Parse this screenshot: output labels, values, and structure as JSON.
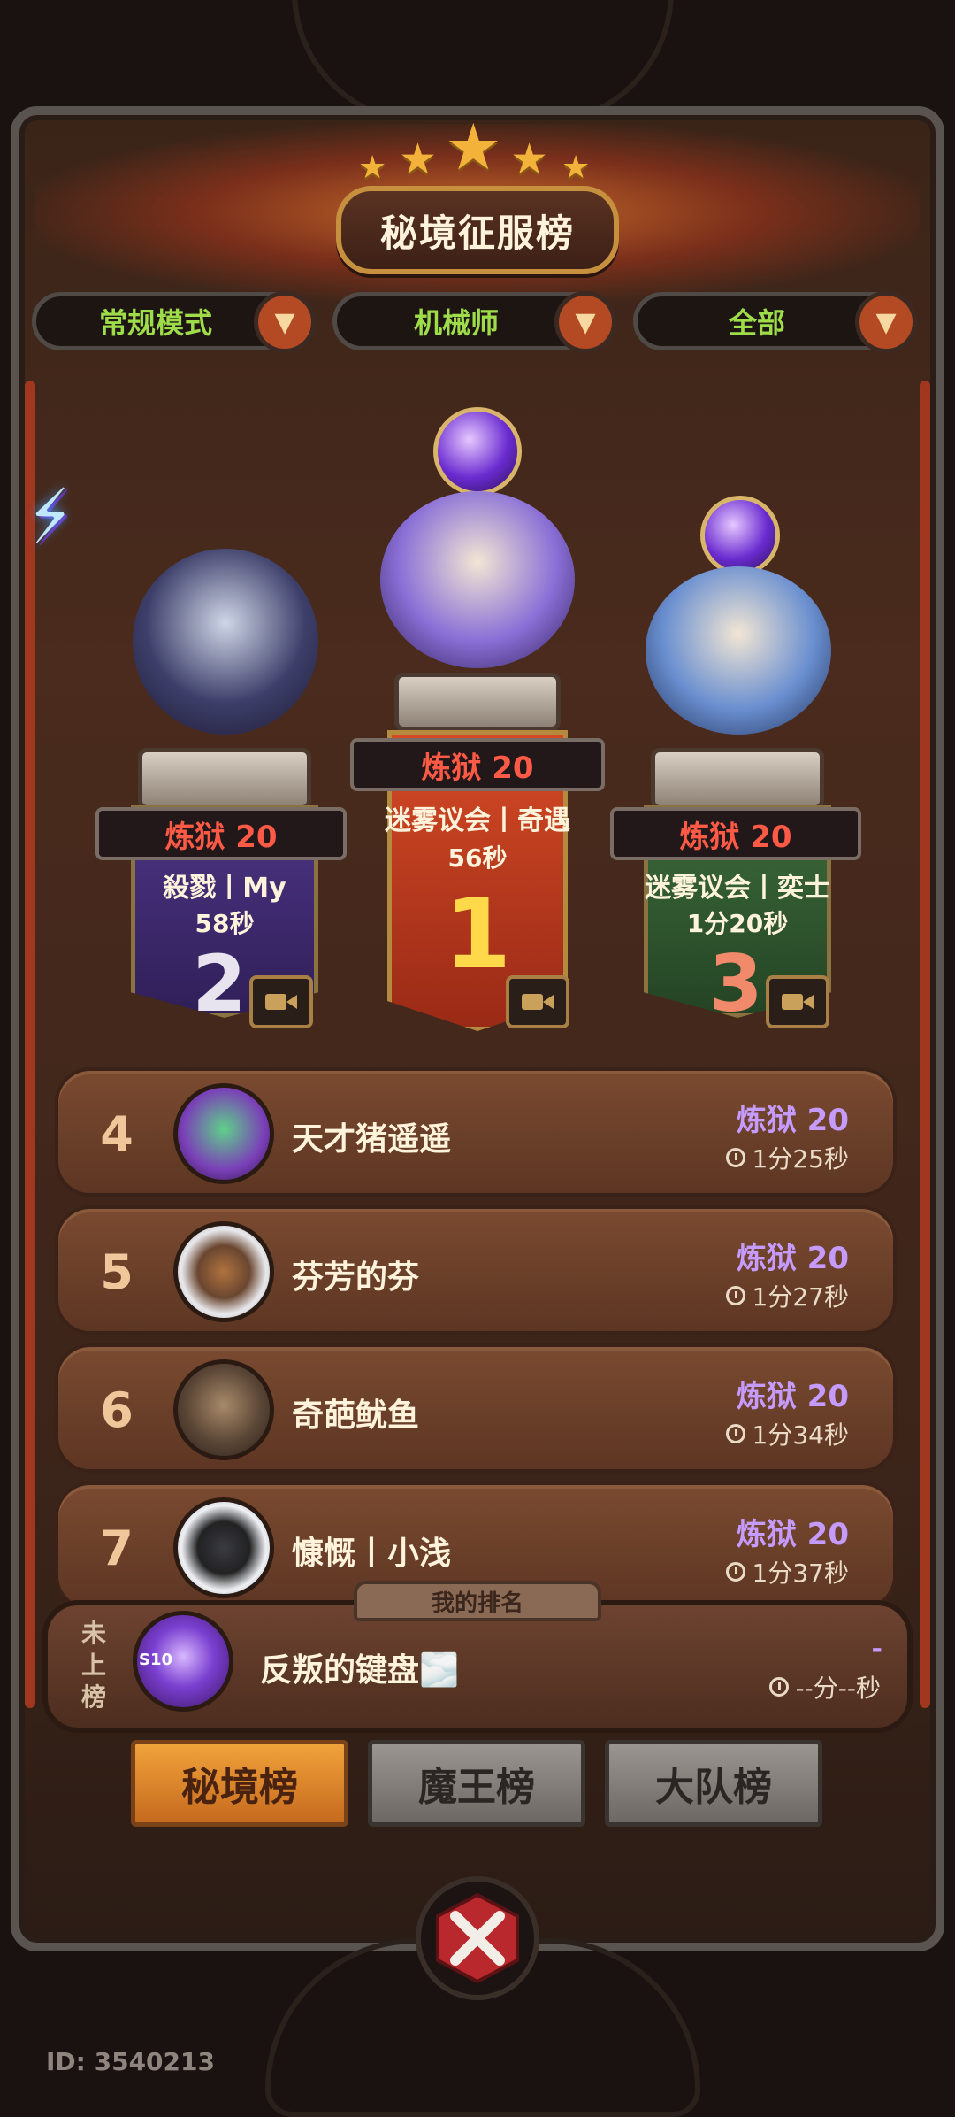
{
  "title": "秘境征服榜",
  "filters": [
    {
      "label": "常规模式"
    },
    {
      "label": "机械师"
    },
    {
      "label": "全部"
    }
  ],
  "podium": [
    {
      "rank": "1",
      "level": "炼狱 20",
      "name": "迷雾议会丨奇遇",
      "time": "56秒",
      "color": "#b5341f"
    },
    {
      "rank": "2",
      "level": "炼狱 20",
      "name": "殺戮丨My",
      "time": "58秒",
      "color": "#3e2a6e"
    },
    {
      "rank": "3",
      "level": "炼狱 20",
      "name": "迷雾议会丨奕士",
      "time": "1分20秒",
      "color": "#2f5230"
    }
  ],
  "rows": [
    {
      "rank": "4",
      "name": "天才猪遥遥",
      "level": "炼狱 20",
      "time": "1分25秒"
    },
    {
      "rank": "5",
      "name": "芬芳的芬",
      "level": "炼狱 20",
      "time": "1分27秒"
    },
    {
      "rank": "6",
      "name": "奇葩鱿鱼",
      "level": "炼狱 20",
      "time": "1分34秒"
    },
    {
      "rank": "7",
      "name": "慷慨丨小浅",
      "level": "炼狱 20",
      "time": "1分37秒"
    }
  ],
  "my_rank": {
    "tab_label": "我的排名",
    "status": "未上榜",
    "name": "反叛的键盘🌫️",
    "level": "-",
    "time": "--分--秒"
  },
  "tabs": [
    {
      "label": "秘境榜",
      "active": true
    },
    {
      "label": "魔王榜",
      "active": false
    },
    {
      "label": "大队榜",
      "active": false
    }
  ],
  "avatar_badge": "S10",
  "user_id": "ID: 3540213",
  "colors": {
    "accent": "#f0a23a",
    "level_purple": "#c59bff",
    "level_red": "#ff5a45",
    "filter_green": "#9fdc4a"
  }
}
